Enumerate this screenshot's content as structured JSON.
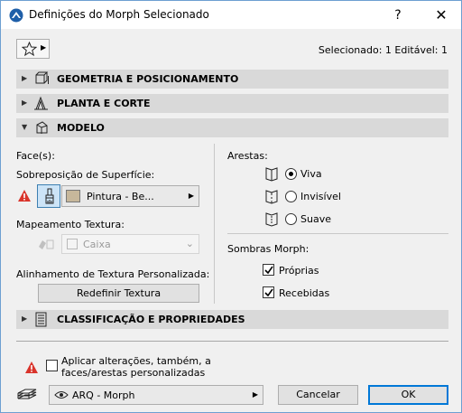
{
  "window": {
    "title": "Definições do Morph Selecionado",
    "help": "?",
    "close": "✕"
  },
  "toolbar": {
    "selection_info": "Selecionado: 1 Editável: 1"
  },
  "sections": {
    "geometry": "GEOMETRIA E POSICIONAMENTO",
    "plan": "PLANTA E CORTE",
    "model": "MODELO",
    "classification": "CLASSIFICAÇÃO E PROPRIEDADES"
  },
  "model": {
    "faces_label": "Face(s):",
    "surface_override_label": "Sobreposição de Superfície:",
    "surface_value": "Pintura - Be...",
    "surface_color": "#c7b79b",
    "texture_mapping_label": "Mapeamento Textura:",
    "texture_mapping_value": "Caixa",
    "custom_texture_label": "Alinhamento de Textura Personalizada:",
    "reset_texture_button": "Redefinir Textura",
    "edges_label": "Arestas:",
    "edges": [
      {
        "label": "Viva",
        "selected": true
      },
      {
        "label": "Invisível",
        "selected": false
      },
      {
        "label": "Suave",
        "selected": false
      }
    ],
    "shadows_label": "Sombras Morph:",
    "shadows": [
      {
        "label": "Próprias",
        "checked": true
      },
      {
        "label": "Recebidas",
        "checked": true
      }
    ]
  },
  "footer": {
    "apply_custom_label": "Aplicar alterações, também, a faces/arestas personalizadas",
    "apply_custom_checked": false,
    "layer_value": "ARQ - Morph",
    "cancel_button": "Cancelar",
    "ok_button": "OK"
  },
  "colors": {
    "accent": "#0078d7",
    "section_bg": "#d9d9d9",
    "warning": "#d9342b"
  }
}
